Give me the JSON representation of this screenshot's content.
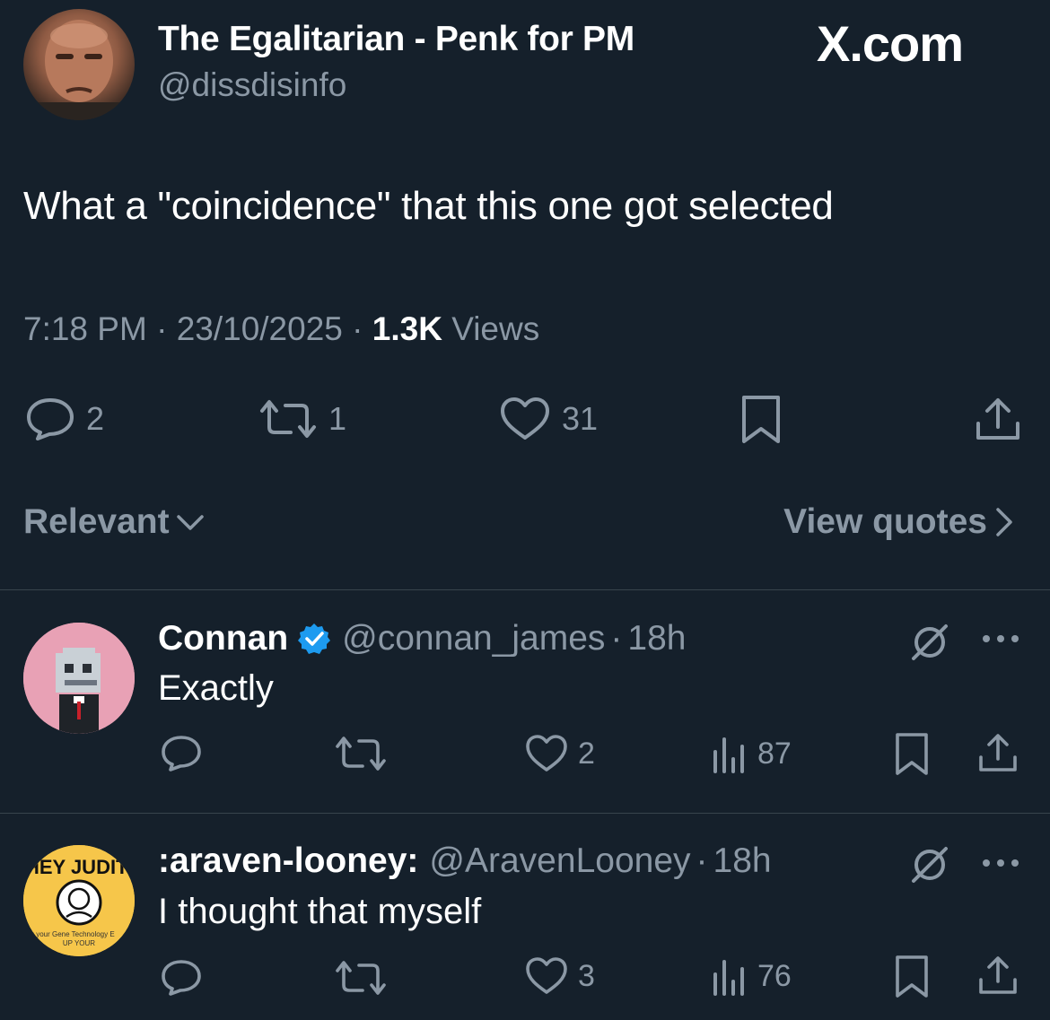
{
  "header": {
    "display_name": "The Egalitarian - Penk for PM",
    "handle": "@dissdisinfo",
    "brand": "X.com"
  },
  "tweet": {
    "text": "What a \"coincidence\" that this one got selected",
    "time": "7:18 PM",
    "date": "23/10/2025",
    "views_count": "1.3K",
    "views_label": "Views",
    "replies": "2",
    "reposts": "1",
    "likes": "31"
  },
  "sort": {
    "label": "Relevant",
    "view_quotes": "View quotes"
  },
  "replies": [
    {
      "name": "Connan",
      "verified": true,
      "handle": "@connan_james",
      "time": "18h",
      "text": "Exactly",
      "likes": "2",
      "views": "87"
    },
    {
      "name": ":araven-looney:",
      "handle": "@AravenLooney",
      "time": "18h",
      "text": "I thought that myself",
      "likes": "3",
      "views": "76",
      "avatar_text": "HEY JUDITH",
      "avatar_subtext": "ck your Gene Technology E",
      "avatar_subtext2": "UP YOUR"
    }
  ],
  "colors": {
    "background": "#15202b",
    "muted": "#8b98a5",
    "verified": "#1d9bf0"
  }
}
